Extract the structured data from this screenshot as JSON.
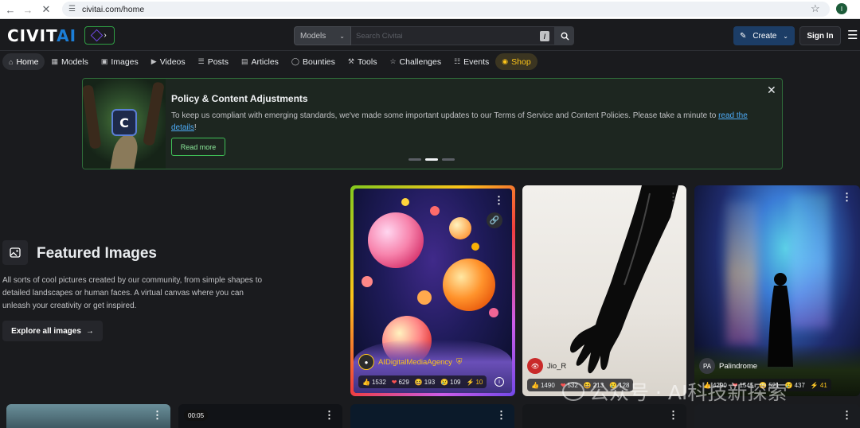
{
  "browser": {
    "url": "civitai.com/home"
  },
  "header": {
    "logo_main": "CIVIT",
    "logo_accent": "AI",
    "search": {
      "scope": "Models",
      "placeholder": "Search Civitai",
      "shortcut": "/"
    },
    "create_label": "Create",
    "signin_label": "Sign In"
  },
  "tabs": [
    {
      "label": "Home",
      "icon": "home-icon"
    },
    {
      "label": "Models",
      "icon": "grid-icon"
    },
    {
      "label": "Images",
      "icon": "image-icon"
    },
    {
      "label": "Videos",
      "icon": "video-icon"
    },
    {
      "label": "Posts",
      "icon": "posts-icon"
    },
    {
      "label": "Articles",
      "icon": "article-icon"
    },
    {
      "label": "Bounties",
      "icon": "bounty-icon"
    },
    {
      "label": "Tools",
      "icon": "tools-icon"
    },
    {
      "label": "Challenges",
      "icon": "trophy-icon"
    },
    {
      "label": "Events",
      "icon": "calendar-icon"
    },
    {
      "label": "Shop",
      "icon": "shop-icon"
    }
  ],
  "banner": {
    "title": "Policy & Content Adjustments",
    "text": "To keep us compliant with emerging standards, we've made some important updates to our Terms of Service and Content Policies. Please take a minute to ",
    "link": "read the details",
    "text_end": "!",
    "cta": "Read more",
    "badge_letter": "C"
  },
  "featured": {
    "title": "Featured Images",
    "description": "All sorts of cool pictures created by our community, from simple shapes to detailed landscapes or human faces. A virtual canvas where you can unleash your creativity or get inspired.",
    "cta": "Explore all images"
  },
  "cards": [
    {
      "user": "AIDigitalMediaAgency",
      "reactions": {
        "like": "1532",
        "heart": "629",
        "laugh": "193",
        "cry": "109",
        "tip": "10"
      }
    },
    {
      "user": "Jio_R",
      "reactions": {
        "like": "1490",
        "heart": "532",
        "laugh": "213",
        "cry": "128"
      }
    },
    {
      "user": "Palindrome",
      "avatar_initials": "PA",
      "reactions": {
        "like": "4290",
        "heart": "1545",
        "laugh": "521",
        "cry": "437",
        "tip": "41"
      }
    }
  ],
  "bottom_cards": [
    {
      "duration": "00:05"
    }
  ],
  "watermark": "公众号 · AI科技新探索"
}
